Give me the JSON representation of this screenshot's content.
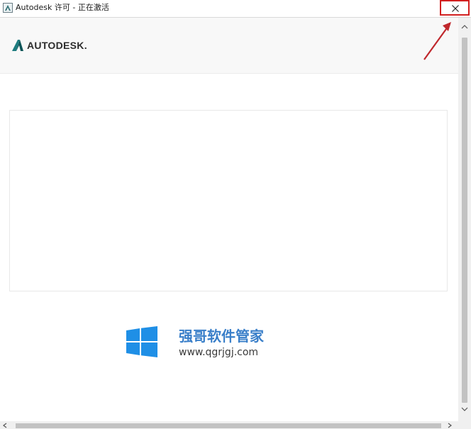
{
  "window": {
    "title": "Autodesk 许可 - 正在激活"
  },
  "header": {
    "logo_text": "AUTODESK."
  },
  "watermark": {
    "title": "强哥软件管家",
    "url": "www.qgrjgj.com"
  },
  "colors": {
    "close_highlight": "#d21f1f",
    "watermark_blue": "#3a7fc9",
    "header_bg": "#f8f8f8"
  },
  "icons": {
    "app": "autodesk-app-icon",
    "close": "close-icon",
    "windows_logo": "windows-logo-icon"
  }
}
